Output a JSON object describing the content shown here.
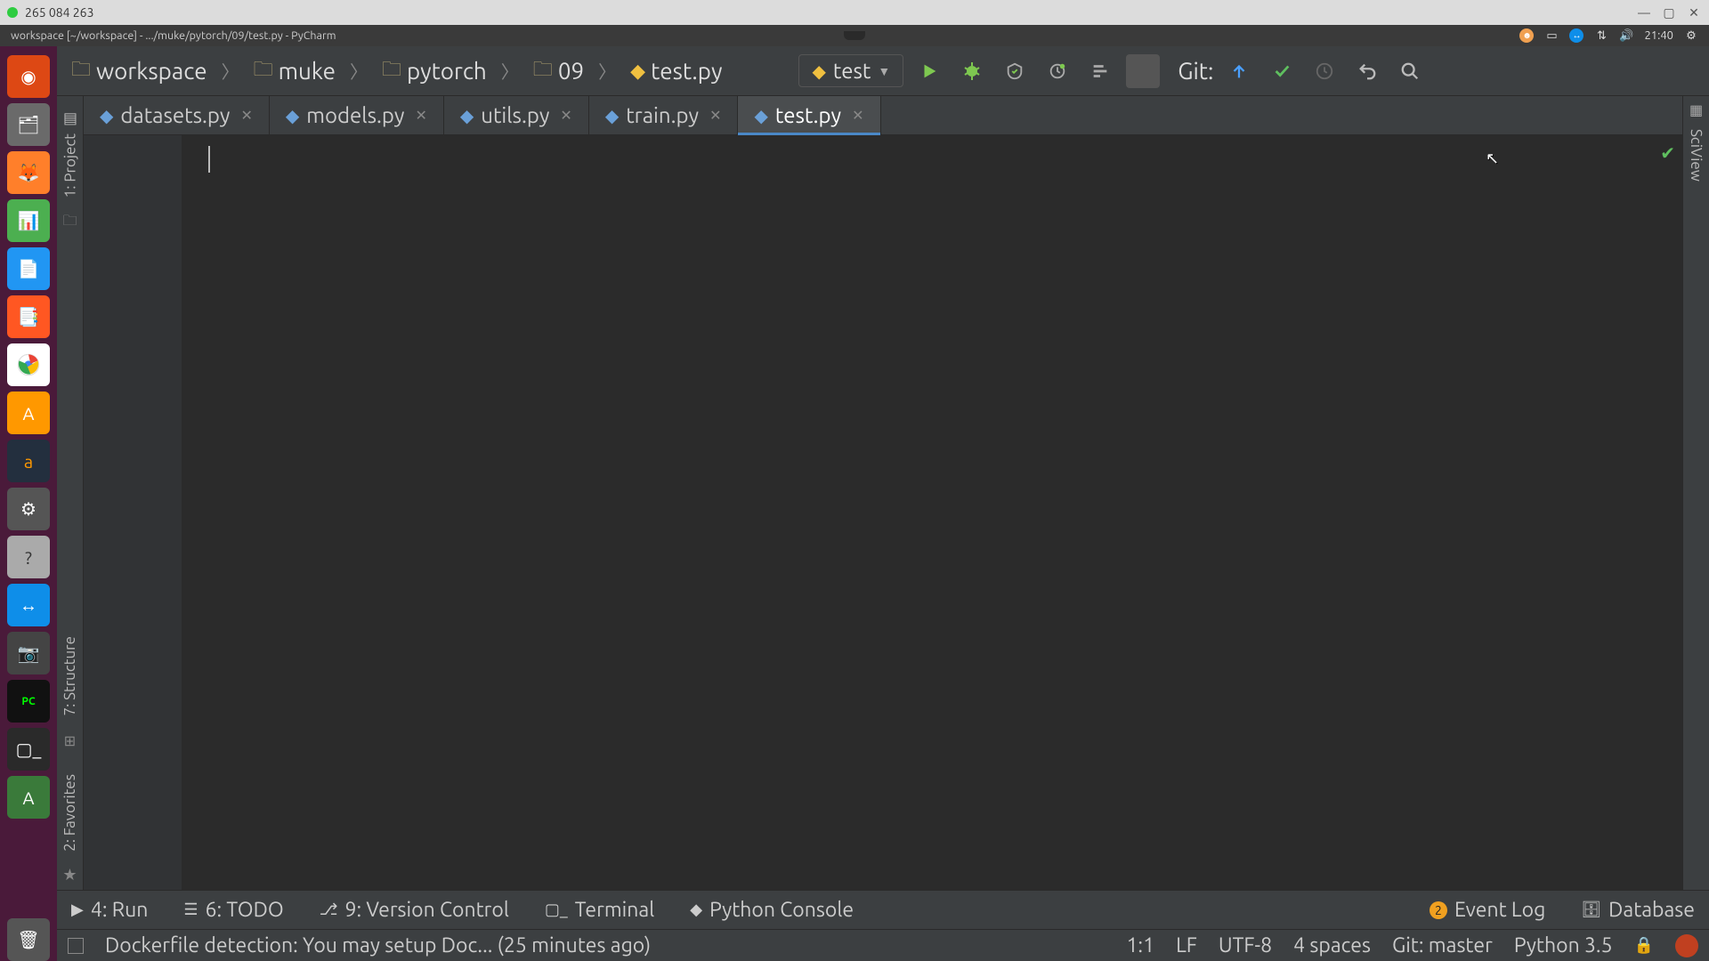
{
  "os": {
    "top_text": "265 084 263",
    "time": "21:40"
  },
  "window_title": "workspace [~/workspace] - .../muke/pytorch/09/test.py - PyCharm",
  "breadcrumb": {
    "items": [
      {
        "name": "workspace",
        "kind": "folder"
      },
      {
        "name": "muke",
        "kind": "folder"
      },
      {
        "name": "pytorch",
        "kind": "folder"
      },
      {
        "name": "09",
        "kind": "folder"
      },
      {
        "name": "test.py",
        "kind": "py"
      }
    ]
  },
  "run_config": {
    "label": "test"
  },
  "git_label": "Git:",
  "left_tabs": {
    "project": "1: Project",
    "structure": "7: Structure",
    "favorites": "2: Favorites"
  },
  "right_tabs": {
    "sciview": "SciView"
  },
  "tabs": [
    {
      "label": "datasets.py",
      "active": false
    },
    {
      "label": "models.py",
      "active": false
    },
    {
      "label": "utils.py",
      "active": false
    },
    {
      "label": "train.py",
      "active": false
    },
    {
      "label": "test.py",
      "active": true
    }
  ],
  "bottom_tools": {
    "run": "4: Run",
    "todo": "6: TODO",
    "vcs": "9: Version Control",
    "terminal": "Terminal",
    "pyconsole": "Python Console",
    "event_log": "Event Log",
    "event_log_badge": "2",
    "database": "Database"
  },
  "statusbar": {
    "message": "Dockerfile detection: You may setup Doc... (25 minutes ago)",
    "pos": "1:1",
    "eol": "LF",
    "encoding": "UTF-8",
    "indent": "4 spaces",
    "git": "Git: master",
    "python": "Python 3.5"
  }
}
